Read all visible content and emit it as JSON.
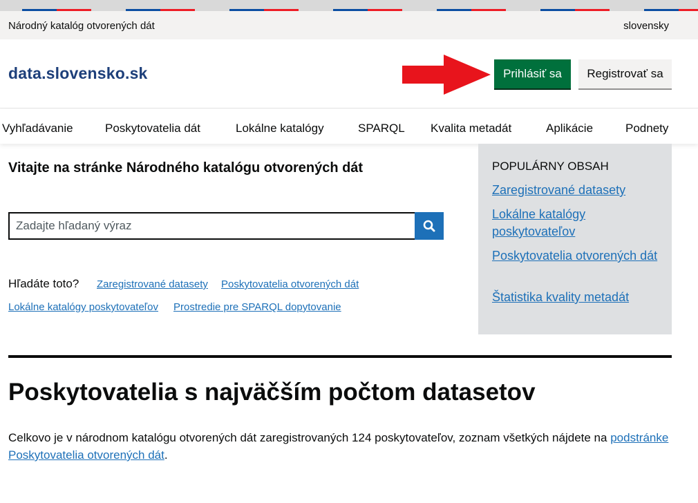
{
  "gov_bar": {
    "title": "Národný katalóg otvorených dát",
    "language": "slovensky"
  },
  "header": {
    "logo": "data.slovensko.sk",
    "login_label": "Prihlásiť sa",
    "register_label": "Registrovať sa",
    "annotation": "red-arrow-pointing-at-login"
  },
  "nav": {
    "items": [
      "Vyhľadávanie",
      "Poskytovatelia dát",
      "Lokálne katalógy",
      "SPARQL",
      "Kvalita metadát",
      "Aplikácie",
      "Podnety"
    ]
  },
  "main": {
    "welcome": "Vitajte na stránke Národného katalógu otvorených dát",
    "search": {
      "placeholder": "Zadajte hľadaný výraz",
      "value": "",
      "button_icon": "search-icon"
    },
    "suggestions": {
      "label": "Hľadáte toto?",
      "links": [
        "Zaregistrované datasety",
        "Poskytovatelia otvorených dát",
        "Lokálne katalógy poskytovateľov",
        "Prostredie pre SPARQL dopytovanie"
      ]
    }
  },
  "popular": {
    "heading": "POPULÁRNY OBSAH",
    "links": [
      "Zaregistrované datasety",
      "Lokálne katalógy poskytovateľov",
      "Poskytovatelia otvorených dát",
      "Štatistika kvality metadát"
    ]
  },
  "providers": {
    "title": "Poskytovatelia s najväčším počtom datasetov",
    "intro_text": "Celkovo je v národnom katalógu otvorených dát zaregistrovaných 124 poskytovateľov, zoznam všetkých nájdete na",
    "intro_link": "podstránke Poskytovatelia otvorených dát",
    "intro_end": "."
  },
  "colors": {
    "primary_link": "#1d70b8",
    "login_button": "#00703c",
    "logo": "#1d3f7a",
    "annotation_arrow": "#e8141c",
    "sidebar_bg": "#dee0e2"
  }
}
